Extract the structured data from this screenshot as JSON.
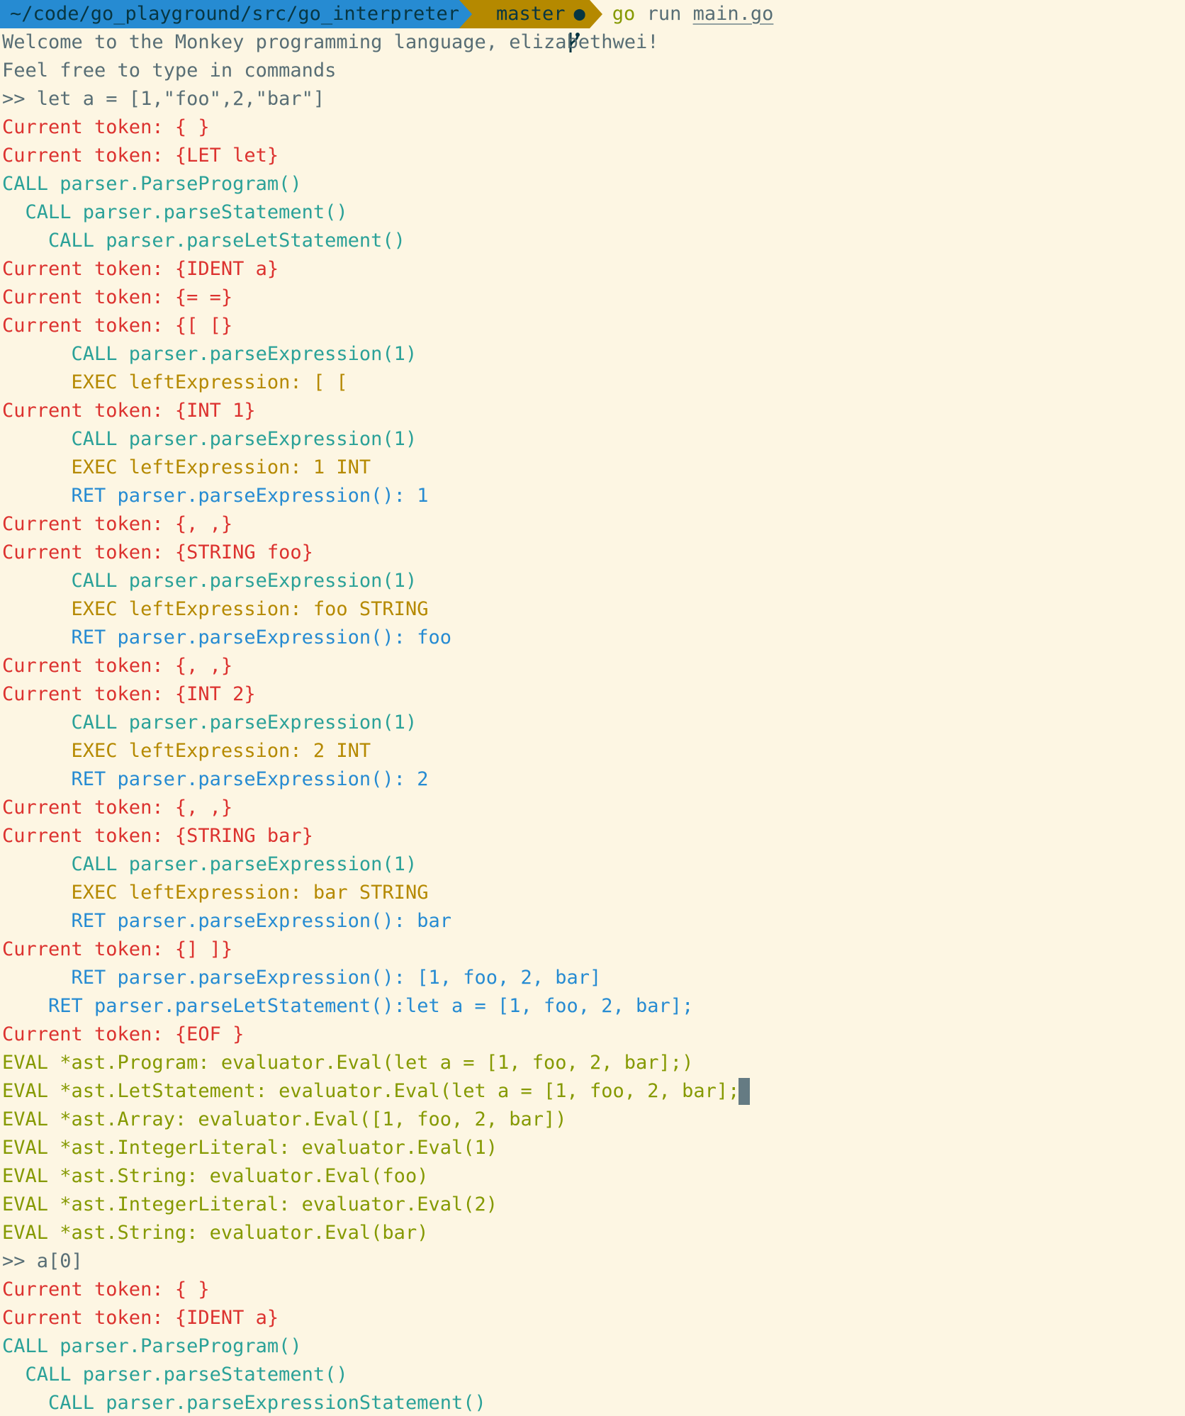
{
  "prompt": {
    "path": "~/code/go_playground/src/go_interpreter",
    "branch": "master",
    "dirty_mark": "●",
    "command_go": "go",
    "command_run": "run",
    "command_file": "main.go"
  },
  "colors": {
    "background": "#fdf6e3",
    "default": "#586e75",
    "token": "#dc322f",
    "call": "#2aa198",
    "exec": "#b58900",
    "ret": "#268bd2",
    "eval": "#859900",
    "path_segment": "#268bd2",
    "git_segment": "#b58900",
    "cursor": "#657b83"
  },
  "icons": {
    "branch": "git-branch-icon"
  },
  "lines": [
    {
      "text": "Welcome to the Monkey programming language, elizabethwei!",
      "kind": "default"
    },
    {
      "text": "Feel free to type in commands",
      "kind": "default"
    },
    {
      "text": ">> let a = [1,\"foo\",2,\"bar\"]",
      "kind": "default"
    },
    {
      "text": "Current token: { }",
      "kind": "token"
    },
    {
      "text": "Current token: {LET let}",
      "kind": "token"
    },
    {
      "text": "CALL parser.ParseProgram()",
      "kind": "call"
    },
    {
      "text": "  CALL parser.parseStatement()",
      "kind": "call"
    },
    {
      "text": "    CALL parser.parseLetStatement()",
      "kind": "call"
    },
    {
      "text": "Current token: {IDENT a}",
      "kind": "token"
    },
    {
      "text": "Current token: {= =}",
      "kind": "token"
    },
    {
      "text": "Current token: {[ [}",
      "kind": "token"
    },
    {
      "text": "      CALL parser.parseExpression(1)",
      "kind": "call"
    },
    {
      "text": "      EXEC leftExpression: [ [",
      "kind": "exec"
    },
    {
      "text": "Current token: {INT 1}",
      "kind": "token"
    },
    {
      "text": "      CALL parser.parseExpression(1)",
      "kind": "call"
    },
    {
      "text": "      EXEC leftExpression: 1 INT",
      "kind": "exec"
    },
    {
      "text": "      RET parser.parseExpression(): 1",
      "kind": "ret"
    },
    {
      "text": "Current token: {, ,}",
      "kind": "token"
    },
    {
      "text": "Current token: {STRING foo}",
      "kind": "token"
    },
    {
      "text": "      CALL parser.parseExpression(1)",
      "kind": "call"
    },
    {
      "text": "      EXEC leftExpression: foo STRING",
      "kind": "exec"
    },
    {
      "text": "      RET parser.parseExpression(): foo",
      "kind": "ret"
    },
    {
      "text": "Current token: {, ,}",
      "kind": "token"
    },
    {
      "text": "Current token: {INT 2}",
      "kind": "token"
    },
    {
      "text": "      CALL parser.parseExpression(1)",
      "kind": "call"
    },
    {
      "text": "      EXEC leftExpression: 2 INT",
      "kind": "exec"
    },
    {
      "text": "      RET parser.parseExpression(): 2",
      "kind": "ret"
    },
    {
      "text": "Current token: {, ,}",
      "kind": "token"
    },
    {
      "text": "Current token: {STRING bar}",
      "kind": "token"
    },
    {
      "text": "      CALL parser.parseExpression(1)",
      "kind": "call"
    },
    {
      "text": "      EXEC leftExpression: bar STRING",
      "kind": "exec"
    },
    {
      "text": "      RET parser.parseExpression(): bar",
      "kind": "ret"
    },
    {
      "text": "Current token: {] ]}",
      "kind": "token"
    },
    {
      "text": "      RET parser.parseExpression(): [1, foo, 2, bar]",
      "kind": "ret"
    },
    {
      "text": "    RET parser.parseLetStatement():let a = [1, foo, 2, bar];",
      "kind": "ret"
    },
    {
      "text": "Current token: {EOF }",
      "kind": "token"
    },
    {
      "text": "EVAL *ast.Program: evaluator.Eval(let a = [1, foo, 2, bar];)",
      "kind": "eval"
    },
    {
      "text": "EVAL *ast.LetStatement: evaluator.Eval(let a = [1, foo, 2, bar];)",
      "kind": "eval"
    },
    {
      "text": "EVAL *ast.Array: evaluator.Eval([1, foo, 2, bar])",
      "kind": "eval"
    },
    {
      "text": "EVAL *ast.IntegerLiteral: evaluator.Eval(1)",
      "kind": "eval"
    },
    {
      "text": "EVAL *ast.String: evaluator.Eval(foo)",
      "kind": "eval"
    },
    {
      "text": "EVAL *ast.IntegerLiteral: evaluator.Eval(2)",
      "kind": "eval"
    },
    {
      "text": "EVAL *ast.String: evaluator.Eval(bar)",
      "kind": "eval"
    },
    {
      "text": ">> a[0]",
      "kind": "default"
    },
    {
      "text": "Current token: { }",
      "kind": "token"
    },
    {
      "text": "Current token: {IDENT a}",
      "kind": "token"
    },
    {
      "text": "CALL parser.ParseProgram()",
      "kind": "call"
    },
    {
      "text": "  CALL parser.parseStatement()",
      "kind": "call"
    },
    {
      "text": "    CALL parser.parseExpressionStatement()",
      "kind": "call"
    }
  ]
}
